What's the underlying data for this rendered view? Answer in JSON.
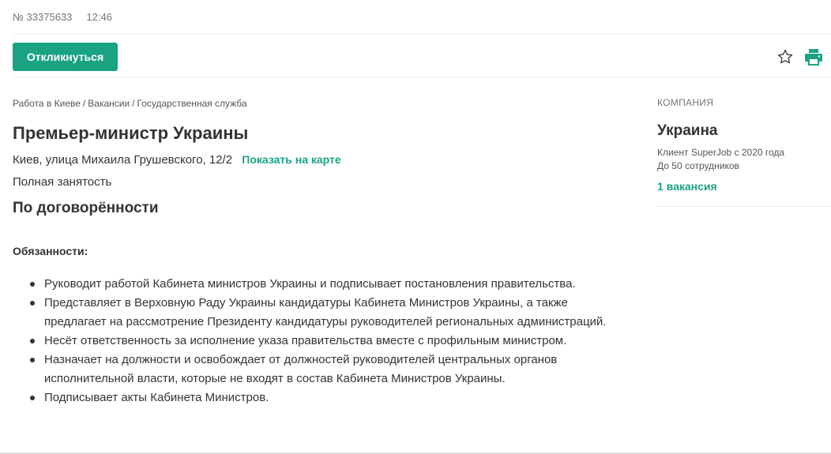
{
  "meta": {
    "vacancy_number": "№ 33375633",
    "time": "12:46"
  },
  "toolbar": {
    "apply_label": "Откликнуться",
    "favorite_icon": "star-outline-icon",
    "print_icon": "printer-icon"
  },
  "breadcrumb": [
    "Работа в Киеве",
    "Вакансии",
    "Государственная служба"
  ],
  "vacancy": {
    "title": "Премьер-министр Украины",
    "address": "Киев, улица Михаила Грушевского, 12/2",
    "map_link": "Показать на карте",
    "employment": "Полная занятость",
    "salary": "По договорённости",
    "duties_heading": "Обязанности:",
    "duties": [
      "Руководит работой Кабинета министров Украины и подписывает постановления правительства.",
      "Представляет в Верховную Раду Украины кандидатуры Кабинета Министров Украины, а также предлагает на рассмотрение Президенту кандидатуры руководителей региональных администраций.",
      "Несёт ответственность за исполнение указа правительства вместе с профильным министром.",
      "Назначает на должности и освобождает от должностей руководителей центральных органов исполнительной власти, которые не входят в состав Кабинета Министров Украины.",
      "Подписывает акты Кабинета Министров."
    ]
  },
  "company": {
    "label": "КОМПАНИЯ",
    "name": "Украина",
    "client_since": "Клиент SuperJob с 2020 года",
    "size": "До 50 сотрудников",
    "vacancies": "1 вакансия"
  },
  "colors": {
    "accent": "#1aa382",
    "text": "#333333",
    "muted": "#757575"
  }
}
